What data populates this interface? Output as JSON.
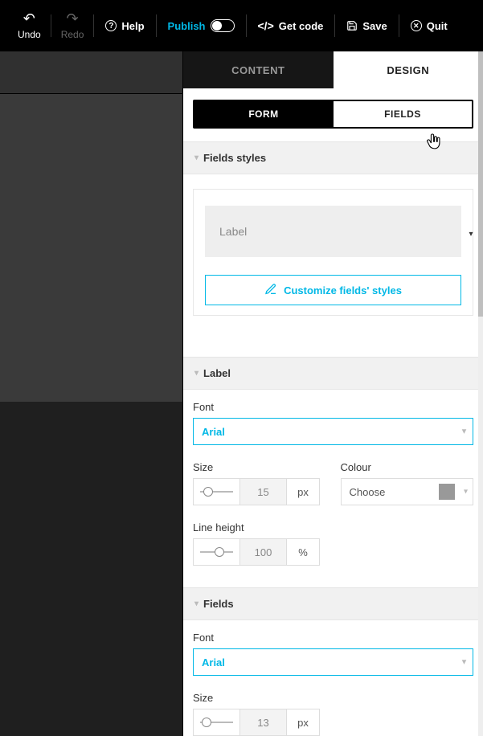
{
  "toolbar": {
    "undo": "Undo",
    "redo": "Redo",
    "help": "Help",
    "publish": "Publish",
    "getcode": "Get code",
    "save": "Save",
    "quit": "Quit"
  },
  "tabs": {
    "content": "CONTENT",
    "design": "DESIGN"
  },
  "subtabs": {
    "form": "FORM",
    "fields": "FIELDS"
  },
  "sections": {
    "fields_styles": "Fields styles",
    "label": "Label",
    "fields": "Fields"
  },
  "fields_styles": {
    "label_placeholder": "Label",
    "customize_btn": "Customize fields' styles"
  },
  "label_section": {
    "font_label": "Font",
    "font_value": "Arial",
    "size_label": "Size",
    "size_value": "15",
    "size_unit": "px",
    "colour_label": "Colour",
    "colour_value": "Choose",
    "lineheight_label": "Line height",
    "lineheight_value": "100",
    "lineheight_unit": "%"
  },
  "fields_section": {
    "font_label": "Font",
    "font_value": "Arial",
    "size_label": "Size",
    "size_value": "13",
    "size_unit": "px"
  }
}
